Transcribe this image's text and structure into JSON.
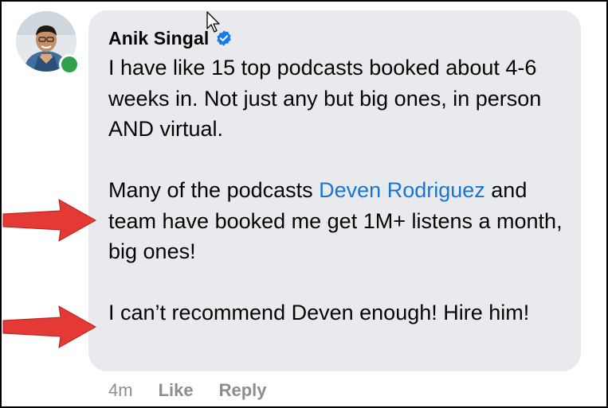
{
  "comment": {
    "author": "Anik Singal",
    "verified": true,
    "online": true,
    "mention": "Deven Rodriguez",
    "paragraph1": "I have like 15 top podcasts booked about 4-6 weeks in.  Not just any but big ones, in person AND virtual.",
    "paragraph2_before": "Many of the podcasts ",
    "paragraph2_after": " and team have booked me get 1M+ listens a month, big ones!",
    "paragraph3": "I can’t recommend Deven enough!  Hire him!"
  },
  "actions": {
    "timestamp": "4m",
    "like_label": "Like",
    "reply_label": "Reply"
  },
  "colors": {
    "bubble": "#e9eaed",
    "mention": "#1876d2",
    "verified": "#1877f2",
    "online": "#31a24c",
    "arrow": "#e53935",
    "meta_text": "#8a8d91"
  },
  "icons": [
    "verified-badge-icon",
    "online-status-icon",
    "red-arrow-icon",
    "mouse-cursor-icon"
  ]
}
